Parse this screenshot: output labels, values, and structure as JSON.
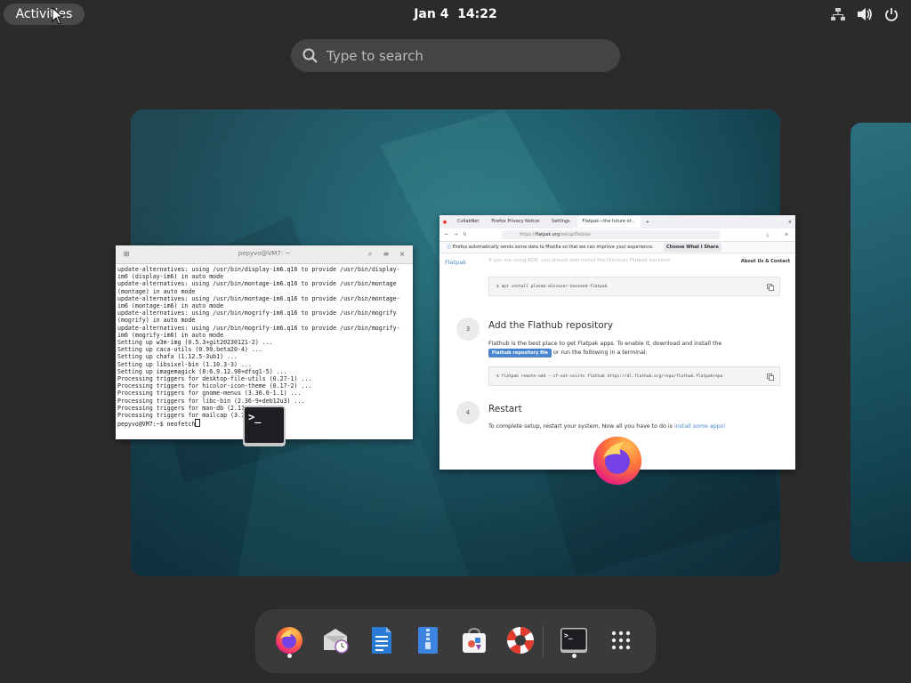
{
  "topbar": {
    "activities_label": "Activities",
    "date": "Jan 4",
    "time": "14:22",
    "icons": [
      "network-wired-icon",
      "volume-icon",
      "power-icon"
    ]
  },
  "search": {
    "placeholder": "Type to search"
  },
  "terminal_window": {
    "title": "pepyvo@VM7: ~",
    "lines": [
      "update-alternatives: using /usr/bin/display-im6.q16 to provide /usr/bin/display-",
      "im6 (display-im6) in auto mode",
      "update-alternatives: using /usr/bin/montage-im6.q16 to provide /usr/bin/montage",
      "(montage) in auto mode",
      "update-alternatives: using /usr/bin/montage-im6.q16 to provide /usr/bin/montage-",
      "im6 (montage-im6) in auto mode",
      "update-alternatives: using /usr/bin/mogrify-im6.q16 to provide /usr/bin/mogrify",
      "(mogrify) in auto mode",
      "update-alternatives: using /usr/bin/mogrify-im6.q16 to provide /usr/bin/mogrify-",
      "im6 (mogrify-im6) in auto mode",
      "Setting up w3m-img (0.5.3+git20230121-2) ...",
      "Setting up caca-utils (0.99.beta20-4) ...",
      "Setting up chafa (1.12.5-3ub1) ...",
      "Setting up libsixel-bin (1.10.3-3) ...",
      "Setting up imagemagick (8:6.9.12.98+dfsg1-5) ...",
      "Processing triggers for desktop-file-utils (0.27-1) ...",
      "Processing triggers for hicolor-icon-theme (0.17-2) ...",
      "Processing triggers for gnome-menus (3.36.0-1.1) ...",
      "Processing triggers for libc-bin (2.36-9+deb12u3) ...",
      "Processing triggers for man-db (2.11.2-2) ...",
      "Processing triggers for mailcap (3.70+nmu1) ..."
    ],
    "prompt": "pepyvo@VM7:~$ neofetch"
  },
  "firefox_window": {
    "tabs": [
      "CollabNet",
      "Firefox Privacy Notice",
      "Settings",
      "Flatpak—the future of..."
    ],
    "url_prefix": "https://",
    "url_host": "flatpak.org",
    "url_path": "/setup/Debian",
    "notice": "Firefox automatically sends some data to Mozilla so that we can improve your experience.",
    "notice_button": "Choose What I Share",
    "site_logo": "Flatpak",
    "site_nav": "About Us & Contact",
    "faded_line": "If you are using KDE, you should also install the Discover Flatpak backend",
    "code1": "$ apt install plasma-discover-backend-flatpak",
    "step3_num": "3",
    "step3_title": "Add the Flathub repository",
    "step3_text1": "Flathub is the best place to get Flatpak apps. To enable it, download and install the",
    "step3_button": "Flathub repository file",
    "step3_text2": "or run the following in a terminal:",
    "code2": "$ flatpak remote-add --if-not-exists flathub https://dl.flathub.org/repo/flathub.flatpakrepo",
    "step4_num": "4",
    "step4_title": "Restart",
    "step4_text": "To complete setup, restart your system. Now all you have to do is",
    "step4_link": "install some apps!"
  },
  "dock": {
    "items": [
      {
        "name": "firefox",
        "running": true
      },
      {
        "name": "evolution-mail",
        "running": false
      },
      {
        "name": "libreoffice-writer",
        "running": false
      },
      {
        "name": "file-roller",
        "running": false
      },
      {
        "name": "software",
        "running": false
      },
      {
        "name": "help",
        "running": false
      },
      {
        "name": "terminal",
        "running": true
      },
      {
        "name": "show-apps",
        "running": false
      }
    ]
  },
  "colors": {
    "panel": "#2b2b2b",
    "accent_link": "#4a86cf",
    "workspace_teal": "#1e5c6b"
  }
}
